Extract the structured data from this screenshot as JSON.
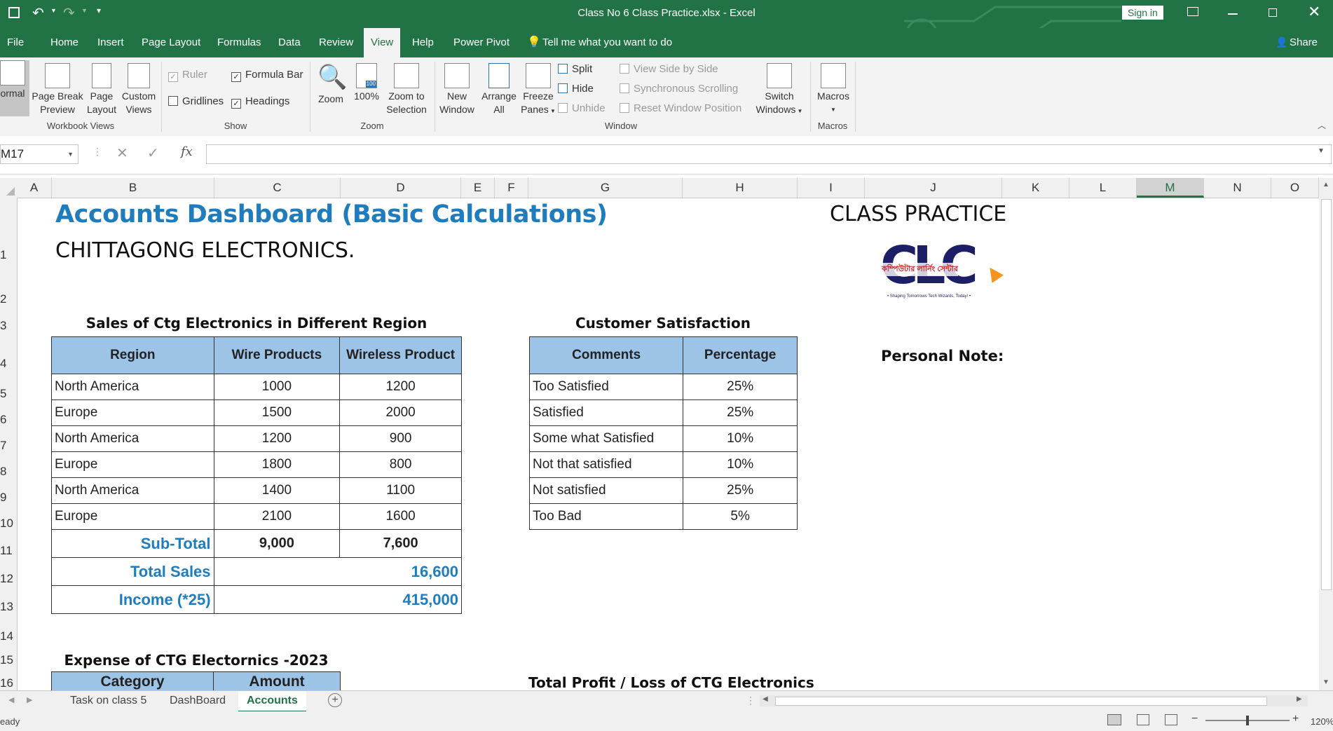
{
  "window": {
    "title": "Class No 6 Class Practice.xlsx  -  Excel",
    "sign_in": "Sign in",
    "share": "Share"
  },
  "ribbon_tabs": [
    "File",
    "Home",
    "Insert",
    "Page Layout",
    "Formulas",
    "Data",
    "Review",
    "View",
    "Help",
    "Power Pivot"
  ],
  "tell_me": "Tell me what you want to do",
  "ribbon": {
    "workbook_views": {
      "label": "Workbook Views",
      "normal": "ormal",
      "page_break_1": "Page Break",
      "page_break_2": "Preview",
      "page_layout_1": "Page",
      "page_layout_2": "Layout",
      "custom_views_1": "Custom",
      "custom_views_2": "Views"
    },
    "show": {
      "label": "Show",
      "ruler": "Ruler",
      "formula_bar": "Formula Bar",
      "gridlines": "Gridlines",
      "headings": "Headings"
    },
    "zoom": {
      "label": "Zoom",
      "zoom": "Zoom",
      "hundred": "100%",
      "zoom_sel_1": "Zoom to",
      "zoom_sel_2": "Selection",
      "icon_100": "100"
    },
    "window": {
      "label": "Window",
      "new_window_1": "New",
      "new_window_2": "Window",
      "arrange_1": "Arrange",
      "arrange_2": "All",
      "freeze_1": "Freeze",
      "freeze_2": "Panes",
      "split": "Split",
      "hide": "Hide",
      "unhide": "Unhide",
      "side_by_side": "View Side by Side",
      "sync_scroll": "Synchronous Scrolling",
      "reset_pos": "Reset Window Position",
      "switch_1": "Switch",
      "switch_2": "Windows"
    },
    "macros": {
      "label": "Macros",
      "macros": "Macros"
    }
  },
  "formula_bar": {
    "name_box": "M17",
    "fx": "fx",
    "value": ""
  },
  "columns": [
    "A",
    "B",
    "C",
    "D",
    "E",
    "F",
    "G",
    "H",
    "I",
    "J",
    "K",
    "L",
    "M",
    "N",
    "O"
  ],
  "rows": [
    "1",
    "2",
    "3",
    "4",
    "5",
    "6",
    "7",
    "8",
    "9",
    "10",
    "11",
    "12",
    "13",
    "14",
    "15",
    "16"
  ],
  "sheet": {
    "title": "Accounts Dashboard (Basic Calculations)",
    "subtitle": "CHITTAGONG ELECTRONICS.",
    "class_practice": "CLASS PRACTICE",
    "personal_note": "Personal Note:",
    "logo_text": "CLC",
    "logo_bengali": "কম্পিউটার লার্নিং সেন্টার",
    "logo_tagline": "• Shaping Tomorrows Tech Wizards, Today! •",
    "sales": {
      "caption": "Sales of Ctg Electronics in Different Region",
      "headers": [
        "Region",
        "Wire Products",
        "Wireless Product"
      ],
      "rows": [
        [
          "North America",
          "1000",
          "1200"
        ],
        [
          "Europe",
          "1500",
          "2000"
        ],
        [
          "North America",
          "1200",
          "900"
        ],
        [
          "Europe",
          "1800",
          "800"
        ],
        [
          "North America",
          "1400",
          "1100"
        ],
        [
          "Europe",
          "2100",
          "1600"
        ]
      ],
      "subtotal_label": "Sub-Total",
      "subtotal_wire": "9,000",
      "subtotal_wireless": "7,600",
      "total_label": "Total Sales",
      "total_value": "16,600",
      "income_label": "Income (*25)",
      "income_value": "415,000"
    },
    "satisfaction": {
      "caption": "Customer Satisfaction",
      "headers": [
        "Comments",
        "Percentage"
      ],
      "rows": [
        [
          "Too Satisfied",
          "25%"
        ],
        [
          "Satisfied",
          "25%"
        ],
        [
          "Some what Satisfied",
          "10%"
        ],
        [
          "Not that satisfied",
          "10%"
        ],
        [
          "Not satisfied",
          "25%"
        ],
        [
          "Too Bad",
          "5%"
        ]
      ]
    },
    "expense": {
      "caption": "Expense of CTG Electornics -2023",
      "headers": [
        "Category",
        "Amount"
      ]
    },
    "profit_caption": "Total Profit / Loss of CTG Electronics"
  },
  "sheet_tabs": [
    "Task on class 5",
    "DashBoard",
    "Accounts"
  ],
  "status": {
    "left": "eady",
    "zoom": "120%"
  }
}
